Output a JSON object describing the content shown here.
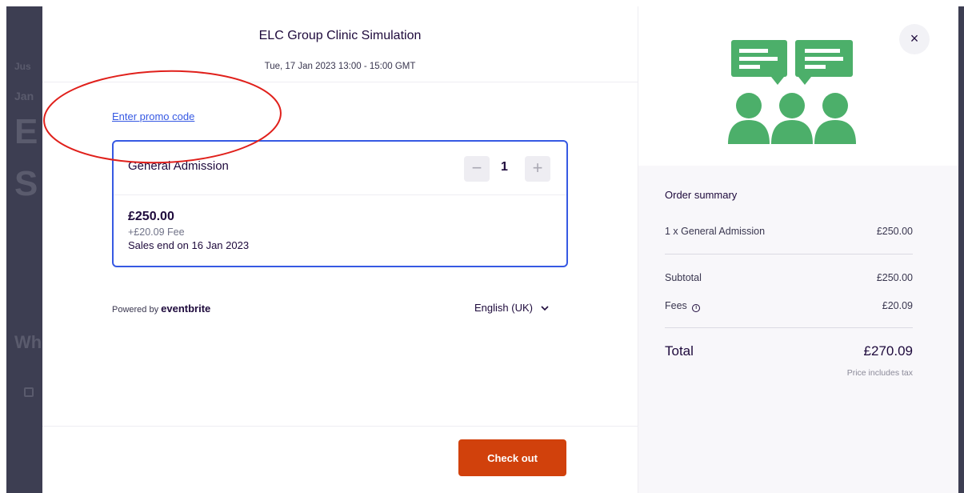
{
  "event": {
    "title": "ELC Group Clinic Simulation",
    "date": "Tue, 17 Jan 2023 13:00 - 15:00 GMT"
  },
  "promo": {
    "link_label": "Enter promo code"
  },
  "ticket": {
    "name": "General Admission",
    "quantity": "1",
    "minus_symbol": "−",
    "plus_symbol": "+",
    "price": "£250.00",
    "fee": "+£20.09 Fee",
    "sales_end": "Sales end on 16 Jan 2023"
  },
  "footer": {
    "powered_prefix": "Powered by",
    "powered_brand": "eventbrite",
    "language": "English (UK)",
    "checkout_label": "Check out"
  },
  "close_symbol": "×",
  "order_summary": {
    "title": "Order summary",
    "line_item_label": "1 x General Admission",
    "line_item_value": "£250.00",
    "subtotal_label": "Subtotal",
    "subtotal_value": "£250.00",
    "fees_label": "Fees",
    "fees_value": "£20.09",
    "total_label": "Total",
    "total_value": "£270.09",
    "tax_note": "Price includes tax"
  },
  "background_page": {
    "fragments": [
      "Jan",
      "E",
      "S",
      "Wh",
      "Jus"
    ]
  },
  "colors": {
    "accent_blue": "#3659e3",
    "checkout_orange": "#d1410c",
    "illustration_green": "#4caf6a",
    "annotation_red": "#e0201b"
  },
  "illustration_icon": "group-discussion-icon"
}
